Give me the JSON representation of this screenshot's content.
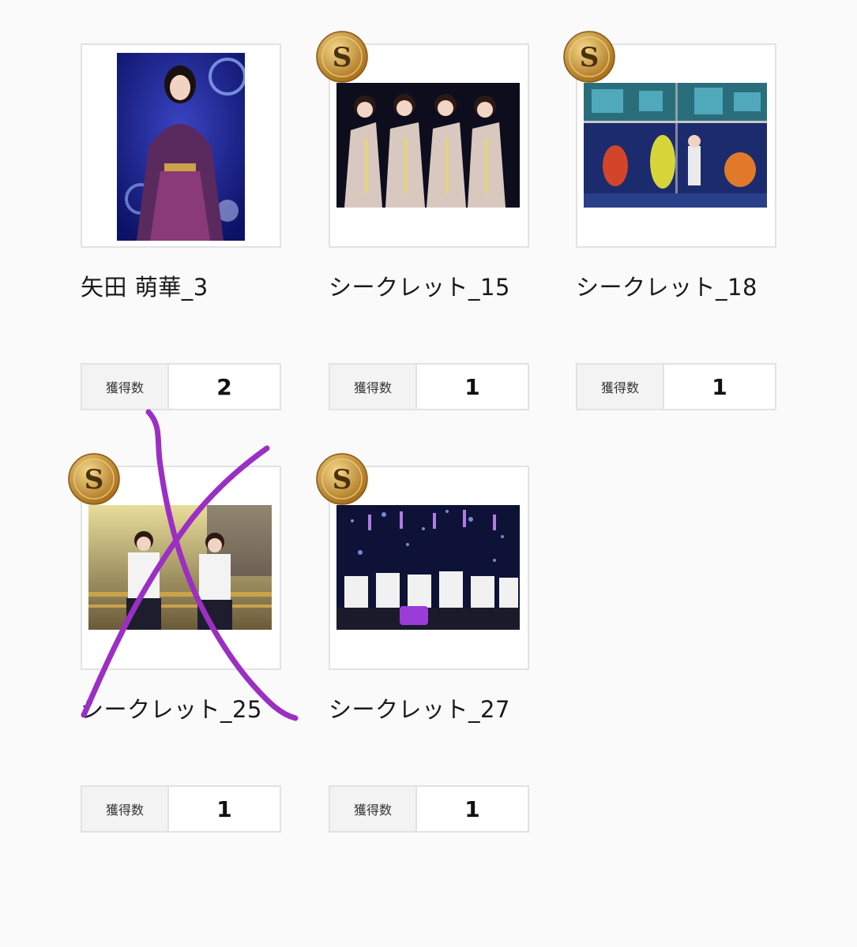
{
  "cards": [
    {
      "title": "矢田 萌華_3",
      "count_label": "獲得数",
      "count": "2",
      "secret": false,
      "crossed_out": false
    },
    {
      "title": "シークレット_15",
      "count_label": "獲得数",
      "count": "1",
      "secret": true,
      "crossed_out": false
    },
    {
      "title": "シークレット_18",
      "count_label": "獲得数",
      "count": "1",
      "secret": true,
      "crossed_out": false
    },
    {
      "title": "シークレット_25",
      "count_label": "獲得数",
      "count": "1",
      "secret": true,
      "crossed_out": true
    },
    {
      "title": "シークレット_27",
      "count_label": "獲得数",
      "count": "1",
      "secret": true,
      "crossed_out": false
    }
  ],
  "badge": {
    "letter": "S",
    "color": "#c8962e"
  },
  "annotation": {
    "color": "#9b2fc4",
    "icon": "cross-mark-scribble"
  }
}
